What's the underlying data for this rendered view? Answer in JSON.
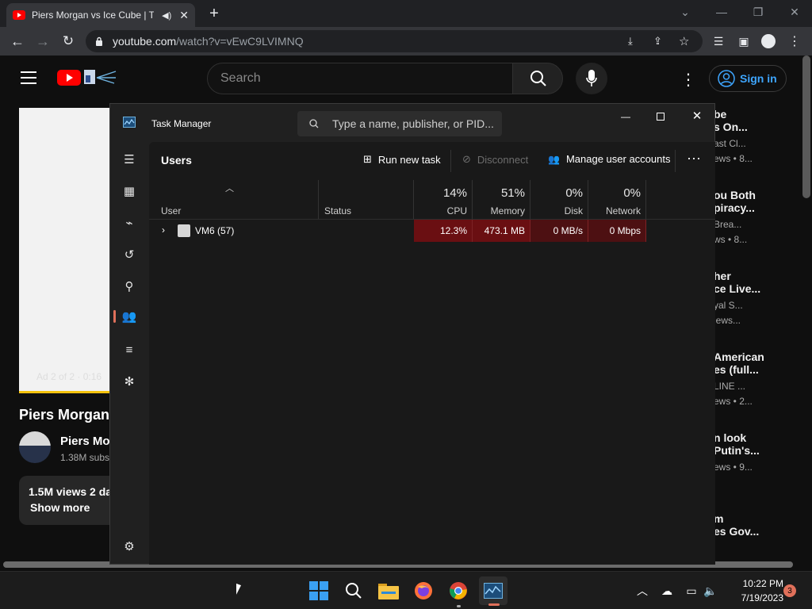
{
  "browser": {
    "tab_title": "Piers Morgan vs Ice Cube | T",
    "url_host": "youtube.com",
    "url_path": "/watch?v=vEwC9LVIMNQ"
  },
  "youtube": {
    "search_placeholder": "Search",
    "signin_label": "Sign in",
    "video_overlay": "Ad 2 of 2 · 0:16",
    "video_title": "Piers Morgan",
    "channel_name": "Piers Mo",
    "subscribers": "1.38M subs",
    "views_line": "1.5M views  2 da",
    "show_more": "Show more",
    "related": [
      {
        "title1": "be",
        "title2": "s On...",
        "channel": "ast Cl...",
        "meta": "ews • 8..."
      },
      {
        "title1": "ou Both",
        "title2": "piracy...",
        "channel": "Brea...",
        "meta": "ws • 8..."
      },
      {
        "title1": "her",
        "title2": "ce Live...",
        "channel": "yal S...",
        "meta": "iews..."
      },
      {
        "title1": "American",
        "title2": "es (full...",
        "channel": "LINE ...",
        "meta": "ews • 2..."
      },
      {
        "title1": "n look",
        "title2": "Putin's...",
        "channel": "",
        "meta": "ews • 9..."
      },
      {
        "title1": "m",
        "title2": "es Gov...",
        "channel": "",
        "meta": ""
      }
    ]
  },
  "taskmanager": {
    "title": "Task Manager",
    "search_placeholder": "Type a name, publisher, or PID...",
    "page_title": "Users",
    "run_new_task": "Run new task",
    "disconnect": "Disconnect",
    "manage_accounts": "Manage user accounts",
    "columns": {
      "user": "User",
      "status": "Status",
      "cpu_pct": "14%",
      "cpu": "CPU",
      "memory_pct": "51%",
      "memory": "Memory",
      "disk_pct": "0%",
      "disk": "Disk",
      "network_pct": "0%",
      "network": "Network"
    },
    "rows": [
      {
        "user": "VM6 (57)",
        "status": "",
        "cpu": "12.3%",
        "memory": "473.1 MB",
        "disk": "0 MB/s",
        "network": "0 Mbps"
      }
    ]
  },
  "taskbar": {
    "time": "10:22 PM",
    "date": "7/19/2023",
    "notification_count": "3"
  }
}
